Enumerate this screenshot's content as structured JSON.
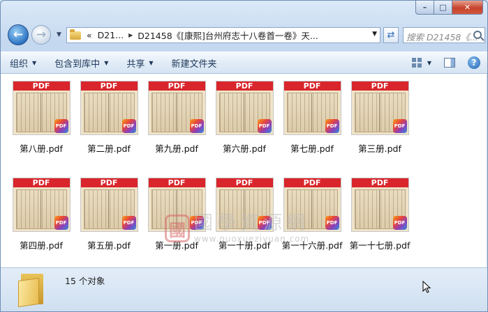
{
  "window": {
    "controls": [
      "minimize",
      "maximize",
      "close"
    ]
  },
  "nav": {
    "breadcrumb": [
      "«",
      "D21...",
      "D21458《[康熙]台州府志十八卷首一卷》天..."
    ],
    "search_placeholder": "搜索 D21458《..."
  },
  "toolbar": {
    "organize": "组织",
    "include_library": "包含到库中",
    "share": "共享",
    "new_folder": "新建文件夹"
  },
  "files": [
    {
      "name": "第八册.pdf"
    },
    {
      "name": "第二册.pdf"
    },
    {
      "name": "第九册.pdf"
    },
    {
      "name": "第六册.pdf"
    },
    {
      "name": "第七册.pdf"
    },
    {
      "name": "第三册.pdf"
    },
    {
      "name": "第四册.pdf"
    },
    {
      "name": "第五册.pdf"
    },
    {
      "name": "第一册.pdf"
    },
    {
      "name": "第一十册.pdf"
    },
    {
      "name": "第一十六册.pdf"
    },
    {
      "name": "第一十七册.pdf"
    }
  ],
  "thumb_label": "PDF",
  "badge_label": "PDF",
  "watermark": {
    "seal": "國",
    "cn": "國學資源網",
    "en": "www.guoxueziyuan.com"
  },
  "status": {
    "count": "15 个对象"
  }
}
